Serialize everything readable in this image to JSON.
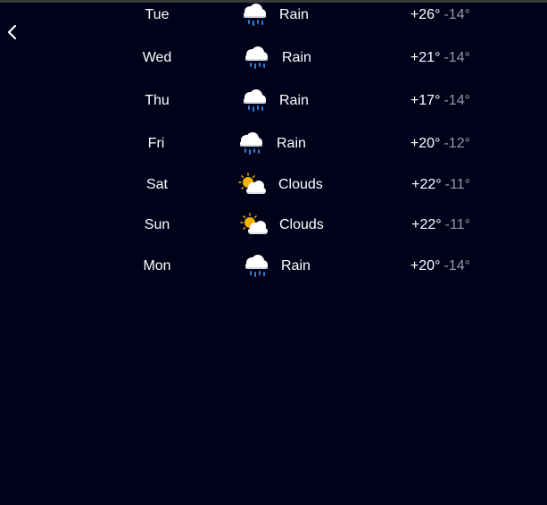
{
  "back": {
    "icon": "chevron-left-icon"
  },
  "forecast": [
    {
      "day": "Tue",
      "icon": "rain-cloud-icon",
      "condition": "Rain",
      "high": "+26°",
      "low": "-14°"
    },
    {
      "day": "Wed",
      "icon": "rain-cloud-icon",
      "condition": "Rain",
      "high": "+21°",
      "low": "-14°"
    },
    {
      "day": "Thu",
      "icon": "rain-cloud-icon",
      "condition": "Rain",
      "high": "+17°",
      "low": "-14°"
    },
    {
      "day": "Fri",
      "icon": "rain-cloud-icon",
      "condition": "Rain",
      "high": "+20°",
      "low": "-12°"
    },
    {
      "day": "Sat",
      "icon": "sun-behind-cloud-icon",
      "condition": "Clouds",
      "high": "+22°",
      "low": "-11°"
    },
    {
      "day": "Sun",
      "icon": "sun-behind-cloud-icon",
      "condition": "Clouds",
      "high": "+22°",
      "low": "-11°"
    },
    {
      "day": "Mon",
      "icon": "rain-cloud-icon",
      "condition": "Rain",
      "high": "+20°",
      "low": "-14°"
    }
  ],
  "colors": {
    "background": "#01021a",
    "text": "#ffffff",
    "low_temp": "#9a9aa2",
    "rain_drop": "#2f7fd8",
    "sun": "#f4b400"
  }
}
